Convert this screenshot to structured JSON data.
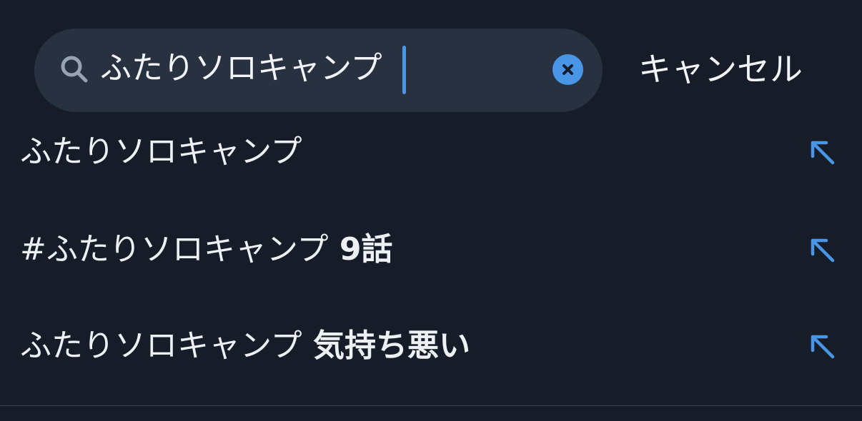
{
  "search": {
    "query": "ふたりソロキャンプ",
    "clear_icon": "clear-circle-icon",
    "search_icon": "magnifier-icon",
    "cancel_label": "キャンセル",
    "caret_color": "#4a96e6"
  },
  "suggestions": [
    {
      "prefix": "ふたりソロキャンプ",
      "suffix": "",
      "icon": "arrow-up-left-icon"
    },
    {
      "prefix": "#ふたりソロキャンプ",
      "suffix": " 9話",
      "icon": "arrow-up-left-icon"
    },
    {
      "prefix": "ふたりソロキャンプ",
      "suffix": " 気持ち悪い",
      "icon": "arrow-up-left-icon"
    }
  ],
  "colors": {
    "background": "#161d29",
    "search_field": "#27313f",
    "accent": "#4a96e6",
    "text": "#eef1f4"
  }
}
